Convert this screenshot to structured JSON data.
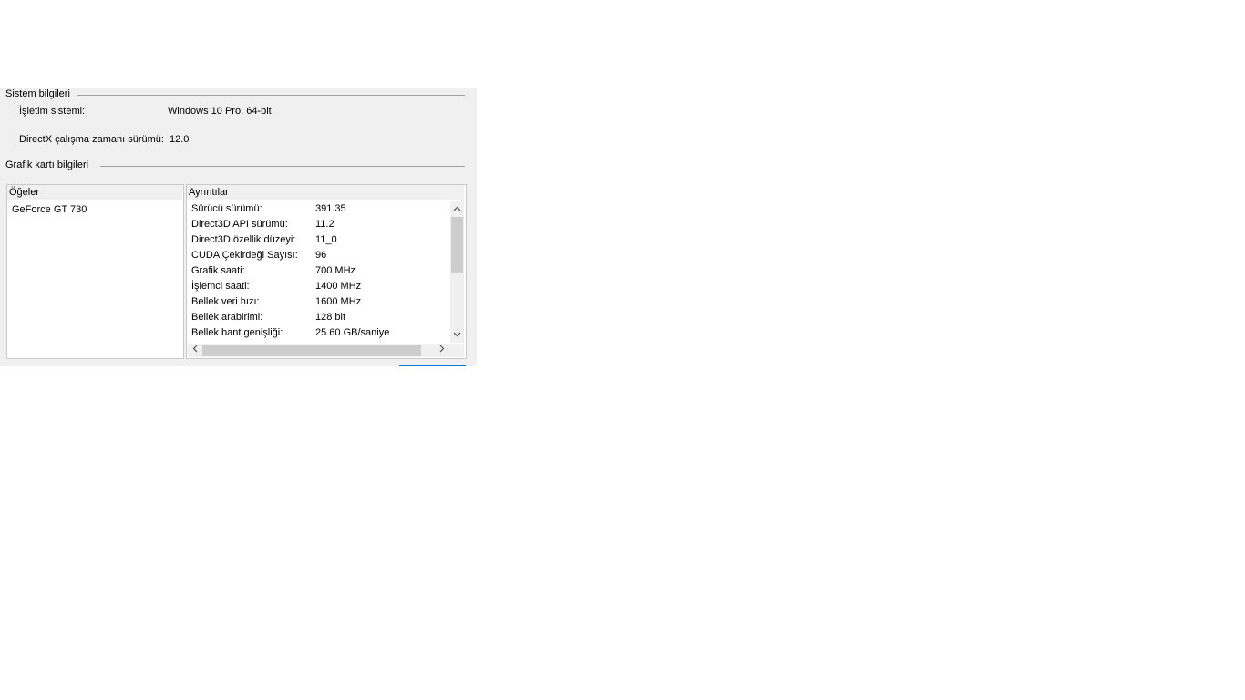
{
  "system_info": {
    "group_title": "Sistem bilgileri",
    "os_label": "İşletim sistemi:",
    "os_value": "Windows 10 Pro, 64-bit",
    "directx_label": "DirectX çalışma zamanı sürümü:",
    "directx_value": "12.0"
  },
  "graphics_info": {
    "group_title": "Grafik kartı bilgileri",
    "items_header": "Öğeler",
    "details_header": "Ayrıntılar",
    "items": [
      "GeForce GT 730"
    ],
    "details": [
      {
        "key": "Sürücü sürümü:",
        "value": "391.35"
      },
      {
        "key": "Direct3D API sürümü:",
        "value": "11.2"
      },
      {
        "key": "Direct3D özellik düzeyi:",
        "value": "11_0"
      },
      {
        "key": "CUDA Çekirdeği Sayısı:",
        "value": "96"
      },
      {
        "key": "Grafik saati:",
        "value": "700 MHz"
      },
      {
        "key": "İşlemci saati:",
        "value": "1400 MHz"
      },
      {
        "key": "Bellek veri hızı:",
        "value": "1600 MHz"
      },
      {
        "key": "Bellek arabirimi:",
        "value": "128 bit"
      },
      {
        "key": "Bellek bant genişliği:",
        "value": "25.60 GB/saniye"
      }
    ]
  },
  "icons": {
    "scroll_up": "chevron-up-icon",
    "scroll_down": "chevron-down-icon",
    "scroll_left": "chevron-left-icon",
    "scroll_right": "chevron-right-icon"
  },
  "colors": {
    "panel_bg": "#f0f0f0",
    "accent": "#0078d7"
  }
}
